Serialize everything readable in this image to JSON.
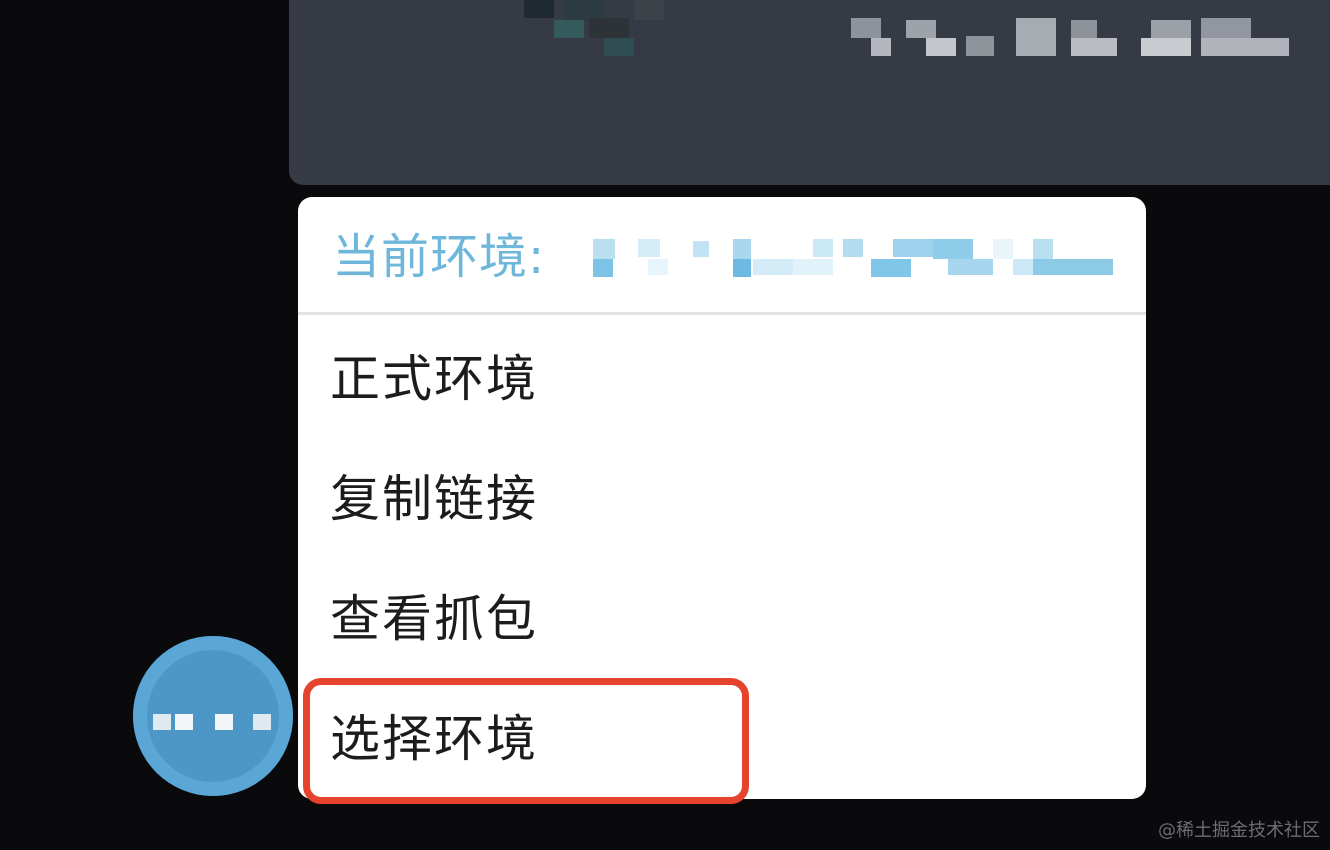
{
  "menu": {
    "header_label": "当前环境:",
    "items": [
      {
        "label": "正式环境"
      },
      {
        "label": "复制链接"
      },
      {
        "label": "查看抓包"
      },
      {
        "label": "选择环境"
      }
    ],
    "highlighted_item": "选择环境"
  },
  "fab": {
    "icon": "more-dots-icon"
  },
  "watermark": "@稀土掘金技术社区",
  "colors": {
    "background": "#0a0a0c",
    "top_card": "#363a45",
    "header_text": "#6eb7db",
    "item_text": "#1c1c1f",
    "highlight_border": "#e5432d",
    "fab": "#4c97c5"
  }
}
